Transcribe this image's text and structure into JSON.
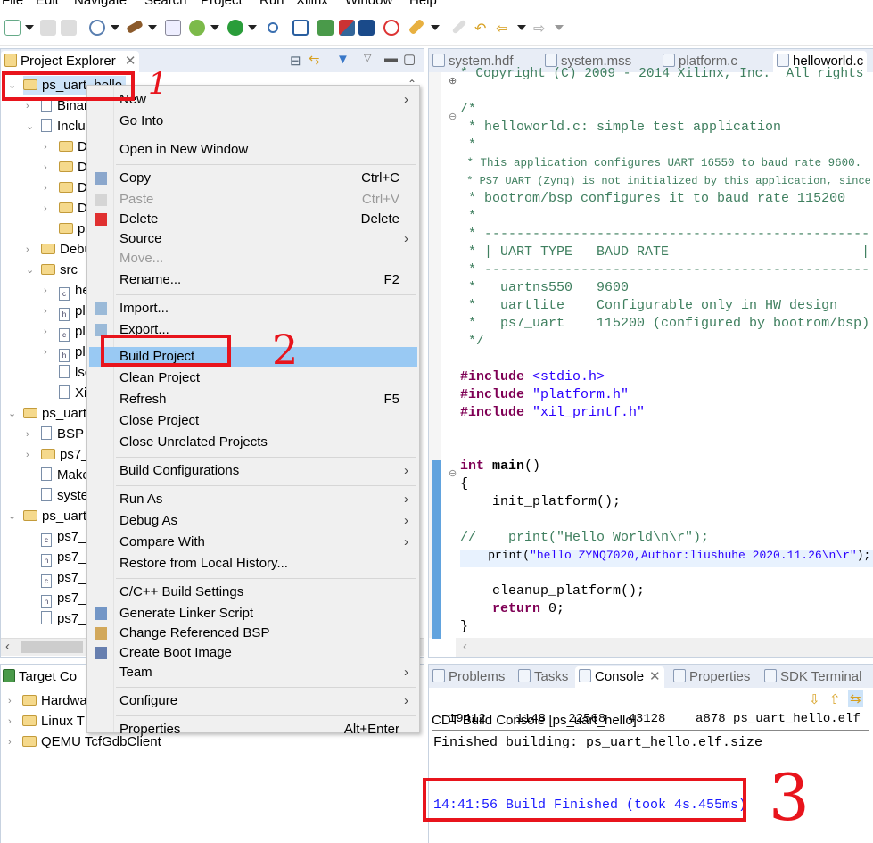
{
  "menubar": [
    "File",
    "Edit",
    "Navigate",
    "Search",
    "Project",
    "Run",
    "Xilinx",
    "Window",
    "Help"
  ],
  "project_explorer": {
    "title": "Project Explorer",
    "tree": [
      {
        "label": "ps_uart_hello",
        "expand": "open",
        "indent": 0,
        "icon": "project-folder-icon",
        "selected": true
      },
      {
        "label": "Binaries",
        "expand": "closed",
        "indent": 1,
        "icon": "binaries-icon"
      },
      {
        "label": "Includes",
        "expand": "open",
        "indent": 1,
        "icon": "includes-icon"
      },
      {
        "label": "D:",
        "expand": "closed",
        "indent": 2,
        "icon": "include-folder-icon"
      },
      {
        "label": "D:",
        "expand": "closed",
        "indent": 2,
        "icon": "include-folder-icon"
      },
      {
        "label": "D:",
        "expand": "closed",
        "indent": 2,
        "icon": "include-folder-icon"
      },
      {
        "label": "D:",
        "expand": "closed",
        "indent": 2,
        "icon": "include-folder-icon"
      },
      {
        "label": "ps",
        "expand": "",
        "indent": 2,
        "icon": "include-folder-icon"
      },
      {
        "label": "Debug",
        "expand": "closed",
        "indent": 1,
        "icon": "folder-icon"
      },
      {
        "label": "src",
        "expand": "open",
        "indent": 1,
        "icon": "folder-icon"
      },
      {
        "label": "he",
        "expand": "closed",
        "indent": 2,
        "icon": "c-file-icon"
      },
      {
        "label": "pl",
        "expand": "closed",
        "indent": 2,
        "icon": "h-file-icon"
      },
      {
        "label": "pl",
        "expand": "closed",
        "indent": 2,
        "icon": "c-file-icon"
      },
      {
        "label": "pl",
        "expand": "closed",
        "indent": 2,
        "icon": "h-file-icon"
      },
      {
        "label": "lsc",
        "expand": "",
        "indent": 2,
        "icon": "linker-script-icon"
      },
      {
        "label": "Xi",
        "expand": "",
        "indent": 2,
        "icon": "text-file-icon"
      },
      {
        "label": "ps_uart",
        "expand": "open",
        "indent": 0,
        "icon": "bsp-project-icon"
      },
      {
        "label": "BSP",
        "expand": "closed",
        "indent": 1,
        "icon": "info-icon"
      },
      {
        "label": "ps7_",
        "expand": "closed",
        "indent": 1,
        "icon": "folder-icon"
      },
      {
        "label": "Make",
        "expand": "",
        "indent": 1,
        "icon": "makefile-icon"
      },
      {
        "label": "syste",
        "expand": "",
        "indent": 1,
        "icon": "mss-file-icon"
      },
      {
        "label": "ps_uart",
        "expand": "open",
        "indent": 0,
        "icon": "hw-project-icon"
      },
      {
        "label": "ps7_",
        "expand": "",
        "indent": 1,
        "icon": "c-file-icon"
      },
      {
        "label": "ps7_",
        "expand": "",
        "indent": 1,
        "icon": "h-file-icon"
      },
      {
        "label": "ps7_",
        "expand": "",
        "indent": 1,
        "icon": "c-file-icon"
      },
      {
        "label": "ps7_",
        "expand": "",
        "indent": 1,
        "icon": "h-file-icon"
      },
      {
        "label": "ps7_",
        "expand": "",
        "indent": 1,
        "icon": "globe-icon"
      }
    ]
  },
  "target_connections": {
    "title": "Target Co",
    "tree": [
      {
        "label": "Hardwa"
      },
      {
        "label": "Linux T"
      },
      {
        "label": "QEMU TcfGdbClient"
      }
    ]
  },
  "context_menu": [
    {
      "label": "New",
      "submenu": true
    },
    {
      "label": "Go Into"
    },
    {
      "sep": true
    },
    {
      "label": "Open in New Window"
    },
    {
      "sep": true
    },
    {
      "label": "Copy",
      "shortcut": "Ctrl+C",
      "icon": "copy-icon"
    },
    {
      "label": "Paste",
      "shortcut": "Ctrl+V",
      "icon": "paste-icon",
      "disabled": true
    },
    {
      "label": "Delete",
      "shortcut": "Delete",
      "icon": "delete-icon"
    },
    {
      "label": "Source",
      "submenu": true
    },
    {
      "label": "Move...",
      "disabled": true
    },
    {
      "label": "Rename...",
      "shortcut": "F2"
    },
    {
      "sep": true
    },
    {
      "label": "Import...",
      "icon": "import-icon"
    },
    {
      "label": "Export...",
      "icon": "export-icon"
    },
    {
      "sep": true
    },
    {
      "label": "Build Project",
      "highlighted": true
    },
    {
      "label": "Clean Project"
    },
    {
      "label": "Refresh",
      "shortcut": "F5"
    },
    {
      "label": "Close Project"
    },
    {
      "label": "Close Unrelated Projects"
    },
    {
      "sep": true
    },
    {
      "label": "Build Configurations",
      "submenu": true
    },
    {
      "sep": true
    },
    {
      "label": "Run As",
      "submenu": true
    },
    {
      "label": "Debug As",
      "submenu": true
    },
    {
      "label": "Compare With",
      "submenu": true
    },
    {
      "label": "Restore from Local History..."
    },
    {
      "sep": true
    },
    {
      "label": "C/C++ Build Settings"
    },
    {
      "label": "Generate Linker Script",
      "icon": "linker-script-icon"
    },
    {
      "label": "Change Referenced BSP",
      "icon": "bsp-icon"
    },
    {
      "label": "Create Boot Image",
      "icon": "boot-image-icon"
    },
    {
      "label": "Team",
      "submenu": true
    },
    {
      "sep": true
    },
    {
      "label": "Configure",
      "submenu": true
    },
    {
      "sep": true
    },
    {
      "label": "Properties",
      "shortcut": "Alt+Enter"
    }
  ],
  "editor": {
    "tabs": [
      "system.hdf",
      "system.mss",
      "platform.c",
      "helloworld.c"
    ],
    "active_tab": 3,
    "lines": [
      [
        [
          "* Copyright (C) 2009 - 2014 Xilinx, Inc.  All rights",
          "c-com"
        ]
      ],
      [],
      [
        [
          "/*",
          "c-com"
        ]
      ],
      [
        [
          " * helloworld.c: simple test application",
          "c-com"
        ]
      ],
      [
        [
          " *",
          "c-com"
        ]
      ],
      [
        [
          " * This application configures UART 16550 to baud rate 9600.",
          "c-com"
        ]
      ],
      [
        [
          " * PS7 UART (Zynq) is not initialized by this application, since",
          "c-com"
        ]
      ],
      [
        [
          " * bootrom/bsp configures it to baud rate 115200",
          "c-com"
        ]
      ],
      [
        [
          " *",
          "c-com"
        ]
      ],
      [
        [
          " * ------------------------------------------------",
          "c-com"
        ]
      ],
      [
        [
          " * | UART TYPE   BAUD RATE                        |",
          "c-com"
        ]
      ],
      [
        [
          " * ------------------------------------------------",
          "c-com"
        ]
      ],
      [
        [
          " *   uartns550   9600",
          "c-com"
        ]
      ],
      [
        [
          " *   uartlite    Configurable only in HW design",
          "c-com"
        ]
      ],
      [
        [
          " *   ps7_uart    115200 (configured by bootrom/bsp)",
          "c-com"
        ]
      ],
      [
        [
          " */",
          "c-com"
        ]
      ],
      [],
      [
        [
          "#include ",
          "c-kw"
        ],
        [
          "<stdio.h>",
          "c-str"
        ]
      ],
      [
        [
          "#include ",
          "c-kw"
        ],
        [
          "\"platform.h\"",
          "c-str"
        ]
      ],
      [
        [
          "#include ",
          "c-kw"
        ],
        [
          "\"xil_printf.h\"",
          "c-str"
        ]
      ],
      [],
      [],
      [
        [
          "int ",
          "c-kw"
        ],
        [
          "main",
          "c-code bold"
        ],
        [
          "()",
          "c-code"
        ]
      ],
      [
        [
          "{",
          "c-code"
        ]
      ],
      [
        [
          "    init_platform();",
          "c-code"
        ]
      ],
      [],
      [
        [
          "//    print(\"Hello World\\n\\r\");",
          "c-com"
        ]
      ],
      [
        [
          "    print(",
          "c-code"
        ],
        [
          "\"hello ZYNQ7020,Author:liushuhe 2020.11.26\\n\\r\"",
          "c-str"
        ],
        [
          ");",
          "c-code"
        ]
      ],
      [],
      [
        [
          "    cleanup_platform();",
          "c-code"
        ]
      ],
      [
        [
          "    return ",
          "c-kw"
        ],
        [
          "0;",
          "c-code"
        ]
      ],
      [
        [
          "}",
          "c-code"
        ]
      ]
    ]
  },
  "bottom": {
    "tabs": [
      "Problems",
      "Tasks",
      "Console",
      "Properties",
      "SDK Terminal"
    ],
    "active_tab": 2,
    "console_title": "CDT Build Console [ps_uart_hello]",
    "lines": [
      {
        "text": "  19412    1148   22568   43128    a878 ps_uart_hello.elf",
        "color": "#000"
      },
      {
        "text": "Finished building: ps_uart_hello.elf.size",
        "color": "#000"
      },
      {
        "text": "",
        "color": "#000"
      },
      {
        "text": "14:41:56 Build Finished (took 4s.455ms)",
        "color": "#1a1aff"
      }
    ]
  },
  "annotations": [
    "1",
    "2",
    "3"
  ],
  "colors": {
    "annotation": "#e8141c",
    "highlight": "#99c9f3",
    "selection": "#cde3f8"
  }
}
